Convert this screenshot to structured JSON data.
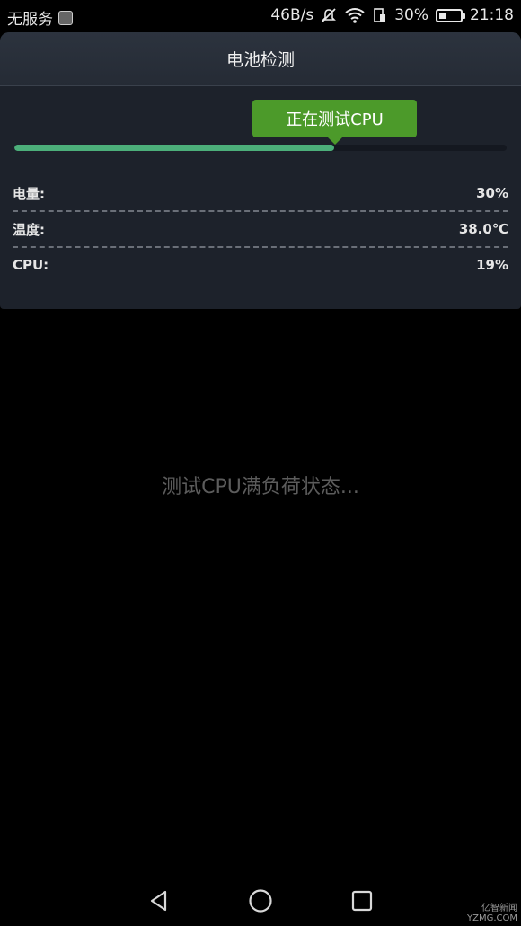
{
  "status_bar": {
    "carrier": "无服务",
    "speed": "46B/s",
    "battery_percent": "30%",
    "battery_level": 0.3,
    "time": "21:18",
    "icons": [
      "sim-icon",
      "mute-icon",
      "wifi-icon",
      "data-icon",
      "battery-icon"
    ]
  },
  "dialog": {
    "title": "电池检测",
    "progress": {
      "label": "正在测试CPU",
      "fraction": 0.65,
      "fill_color": "#4caf7a",
      "label_color": "#4c9a2a"
    },
    "stats": [
      {
        "label": "电量:",
        "value": "30%"
      },
      {
        "label": "温度:",
        "value": "38.0℃"
      },
      {
        "label": "CPU:",
        "value": "19%"
      }
    ]
  },
  "main": {
    "message": "测试CPU满负荷状态..."
  },
  "nav": {
    "icons": [
      "back-icon",
      "home-icon",
      "recents-icon"
    ]
  },
  "watermark": {
    "text": "亿智新闻",
    "sub": "YZMG.COM"
  }
}
